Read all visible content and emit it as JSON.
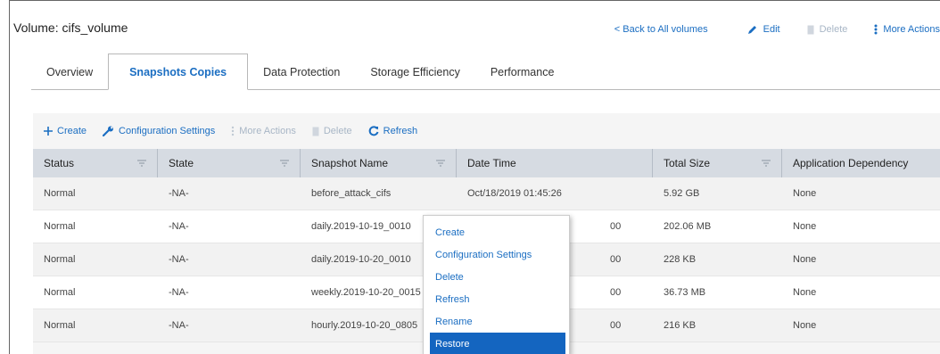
{
  "header": {
    "title": "Volume: cifs_volume",
    "back_link": "< Back to All volumes",
    "edit": "Edit",
    "delete": "Delete",
    "more_actions": "More Actions"
  },
  "tabs": [
    {
      "label": "Overview"
    },
    {
      "label": "Snapshots Copies"
    },
    {
      "label": "Data Protection"
    },
    {
      "label": "Storage Efficiency"
    },
    {
      "label": "Performance"
    }
  ],
  "toolbar": {
    "create": "Create",
    "config": "Configuration Settings",
    "more_actions": "More Actions",
    "delete": "Delete",
    "refresh": "Refresh"
  },
  "table": {
    "headers": [
      "Status",
      "State",
      "Snapshot Name",
      "Date Time",
      "Total Size",
      "Application Dependency"
    ],
    "rows": [
      {
        "status": "Normal",
        "state": "-NA-",
        "name": "before_attack_cifs",
        "datetime": "Oct/18/2019 01:45:26",
        "size": "5.92 GB",
        "dependency": "None"
      },
      {
        "status": "Normal",
        "state": "-NA-",
        "name": "daily.2019-10-19_0010",
        "datetime": "00",
        "size": "202.06 MB",
        "dependency": "None"
      },
      {
        "status": "Normal",
        "state": "-NA-",
        "name": "daily.2019-10-20_0010",
        "datetime": "00",
        "size": "228 KB",
        "dependency": "None"
      },
      {
        "status": "Normal",
        "state": "-NA-",
        "name": "weekly.2019-10-20_0015",
        "datetime": "00",
        "size": "36.73 MB",
        "dependency": "None"
      },
      {
        "status": "Normal",
        "state": "-NA-",
        "name": "hourly.2019-10-20_0805",
        "datetime": "00",
        "size": "216 KB",
        "dependency": "None"
      }
    ]
  },
  "context_menu": {
    "items": [
      "Create",
      "Configuration Settings",
      "Delete",
      "Refresh",
      "Rename",
      "Restore"
    ],
    "highlighted": "Restore"
  },
  "colors": {
    "accent": "#1b6ec2",
    "header_bg": "#d6dbe2",
    "menu_highlight": "#1465c0",
    "disabled": "#a8b6c6"
  }
}
